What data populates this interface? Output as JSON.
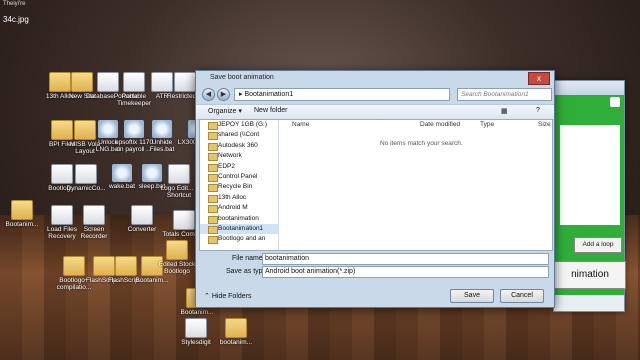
{
  "desktop": {
    "top_label": "Theiyi're",
    "file_label": "34c.jpg",
    "icons": [
      {
        "label": "13th Alloc",
        "kind": "folder"
      },
      {
        "label": "New Site",
        "kind": "folder"
      },
      {
        "label": "DatabasePortable",
        "kind": "file"
      },
      {
        "label": "Portable Timekeeper",
        "kind": "file"
      },
      {
        "label": "ATR",
        "kind": "file"
      },
      {
        "label": "RestrictedF..",
        "kind": "file"
      },
      {
        "label": "BPI Files",
        "kind": "folder"
      },
      {
        "label": "MISB Vola Layout",
        "kind": "folder"
      },
      {
        "label": "Unlock LNG.bat",
        "kind": "gear"
      },
      {
        "label": "epsoftix 1170 on payroll ...",
        "kind": "gear"
      },
      {
        "label": "Unhide Files.bat",
        "kind": "gear"
      },
      {
        "label": "LX300 edp3...",
        "kind": "gear"
      },
      {
        "label": "Bootlog...",
        "kind": "file"
      },
      {
        "label": "DynamicCo...",
        "kind": "file"
      },
      {
        "label": "wake.bat",
        "kind": "gear"
      },
      {
        "label": "sleep.bat",
        "kind": "gear"
      },
      {
        "label": "Logo Edit... - Shortcut",
        "kind": "file"
      },
      {
        "label": "Bootanim...",
        "kind": "folder"
      },
      {
        "label": "Load Files Recovery",
        "kind": "file"
      },
      {
        "label": "Screen Recorder",
        "kind": "file"
      },
      {
        "label": "Converter",
        "kind": "file"
      },
      {
        "label": "Totals Comm...",
        "kind": "file"
      },
      {
        "label": "FlashScrip...",
        "kind": "folder"
      },
      {
        "label": "Bootlogo+ compilatio...",
        "kind": "folder"
      },
      {
        "label": "FlashScrip...",
        "kind": "folder"
      },
      {
        "label": "Bootanim...",
        "kind": "folder"
      },
      {
        "label": "Edited Stock Bootlogo",
        "kind": "folder"
      },
      {
        "label": "Bootanim...",
        "kind": "folder"
      },
      {
        "label": "Stylesdigit",
        "kind": "file"
      },
      {
        "label": "bootanim...",
        "kind": "folder"
      }
    ]
  },
  "back_app": {
    "add_loop_label": "Add a loop",
    "big_label": "nimation"
  },
  "dialog": {
    "title": "Save boot animation",
    "close_glyph": "x",
    "path": "Bootanimation1",
    "search_placeholder": "Search Bootanimation1",
    "organize_label": "Organize ▾",
    "new_folder_label": "New folder",
    "tree": [
      "JEPOY 1GB (G:)",
      "shared (\\\\Cont",
      "Autodesk 360",
      "Network",
      "EDP2",
      "Control Panel",
      "Recycle Bin",
      "13th Alloc",
      "Android M",
      "bootanimation",
      "Bootanimation1",
      "Bootlogo and an"
    ],
    "columns": {
      "name": "Name",
      "date": "Date modified",
      "type": "Type",
      "size": "Size"
    },
    "empty_message": "No items match your search.",
    "file_name_label": "File name:",
    "file_name_value": "bootanimation",
    "save_type_label": "Save as type:",
    "save_type_value": "Android boot animation(*.zip)",
    "hide_folders_label": "Hide Folders",
    "save_label": "Save",
    "cancel_label": "Cancel"
  },
  "colors": {
    "accent": "#2fae3a",
    "dialog_frame": "#c9d9ea"
  }
}
